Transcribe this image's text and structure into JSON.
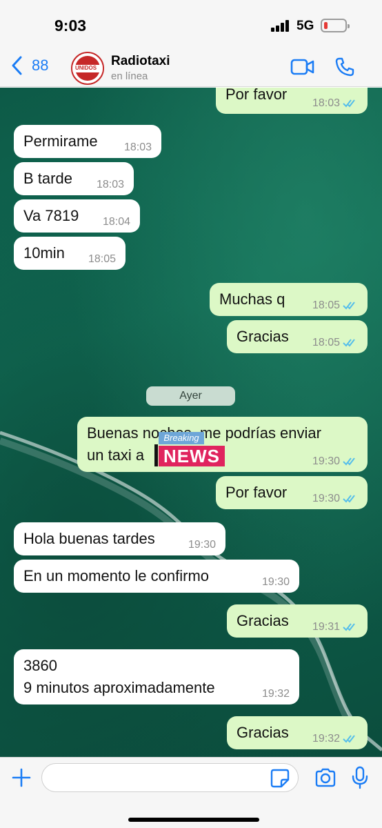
{
  "status_bar": {
    "time": "9:03",
    "network": "5G",
    "battery_color": "#e53935"
  },
  "header": {
    "back_count": "88",
    "contact_name": "Radiotaxi",
    "contact_status": "en línea",
    "avatar_text": "UNIDOS"
  },
  "messages": [
    {
      "dir": "out",
      "text": "Por favor",
      "time": "18:03"
    },
    {
      "dir": "in",
      "text": "Permirame",
      "time": "18:03"
    },
    {
      "dir": "in",
      "text": "B tarde",
      "time": "18:03"
    },
    {
      "dir": "in",
      "text": "Va 7819",
      "time": "18:04"
    },
    {
      "dir": "in",
      "text": "10min",
      "time": "18:05"
    },
    {
      "dir": "out",
      "text": "Muchas q",
      "time": "18:05"
    },
    {
      "dir": "out",
      "text": "Gracias",
      "time": "18:05"
    },
    {
      "dir": "out",
      "text": "Buenas noches, me podrías enviar",
      "text2": "un taxi a",
      "time": "19:30"
    },
    {
      "dir": "out",
      "text": "Por favor",
      "time": "19:30"
    },
    {
      "dir": "in",
      "text": "Hola buenas tardes",
      "time": "19:30"
    },
    {
      "dir": "in",
      "text": "En un momento le confirmo",
      "time": "19:30"
    },
    {
      "dir": "out",
      "text": "Gracias",
      "time": "19:31"
    },
    {
      "dir": "in",
      "text": "3860",
      "text2": "9 minutos aproximadamente",
      "time": "19:32"
    },
    {
      "dir": "out",
      "text": "Gracias",
      "time": "19:32"
    }
  ],
  "day_separator": "Ayer",
  "sticker_overlay": {
    "top": "Breaking",
    "bottom": "NEWS"
  },
  "colors": {
    "accent": "#1a7cf5",
    "outgoing_bubble": "#dcf8c6",
    "incoming_bubble": "#ffffff",
    "read_ticks": "#53bdeb"
  },
  "icons": {
    "back": "chevron-left-icon",
    "video": "video-camera-icon",
    "call": "phone-icon",
    "attach": "plus-icon",
    "sticker": "sticker-icon",
    "camera": "camera-icon",
    "mic": "microphone-icon"
  }
}
